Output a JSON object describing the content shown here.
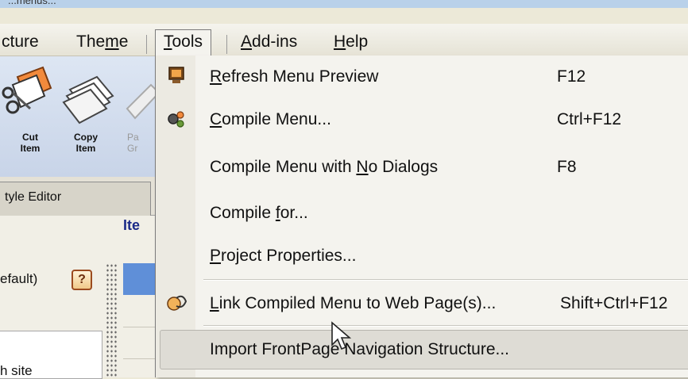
{
  "window": {
    "title_fragment": "...menus..."
  },
  "menubar": {
    "items": [
      {
        "id": "structure",
        "label_pre": "",
        "label_u": "",
        "label_post": "cture"
      },
      {
        "id": "theme",
        "label_pre": "The",
        "label_u": "m",
        "label_post": "e"
      },
      {
        "id": "tools",
        "label_pre": "",
        "label_u": "T",
        "label_post": "ools"
      },
      {
        "id": "addins",
        "label_pre": "",
        "label_u": "A",
        "label_post": "dd-ins"
      },
      {
        "id": "help",
        "label_pre": "",
        "label_u": "H",
        "label_post": "elp"
      }
    ]
  },
  "toolbar": {
    "cut": {
      "line1": "Cut",
      "line2": "Item"
    },
    "copy": {
      "line1": "Copy",
      "line2": "Item"
    },
    "paste": {
      "line1": "Pa",
      "line2": "Gr"
    }
  },
  "tabs": {
    "style_editor": "tyle Editor"
  },
  "panel": {
    "header": "Ite",
    "default_label": "efault)",
    "help_glyph": "?",
    "site_text": "h site"
  },
  "tools_menu": {
    "items": [
      {
        "pre": "",
        "u": "R",
        "post": "efresh Menu Preview",
        "shortcut": "F12",
        "icon": "monitor-refresh-icon"
      },
      {
        "pre": "",
        "u": "C",
        "post": "ompile Menu...",
        "shortcut": "Ctrl+F12",
        "icon": "gears-compile-icon"
      },
      {
        "pre": "Compile Menu with ",
        "u": "N",
        "post": "o Dialogs",
        "shortcut": "F8",
        "icon": ""
      },
      {
        "pre": "Compile ",
        "u": "f",
        "post": "or...",
        "shortcut": "",
        "icon": ""
      },
      {
        "pre": "",
        "u": "P",
        "post": "roject Properties...",
        "shortcut": "",
        "icon": ""
      },
      {
        "pre": "",
        "u": "L",
        "post": "ink Compiled Menu to Web Page(s)...",
        "shortcut": "Shift+Ctrl+F12",
        "icon": "link-web-icon"
      },
      {
        "pre": "Import FrontPage Navigation Structure...",
        "u": "",
        "post": "",
        "shortcut": "",
        "icon": ""
      }
    ]
  },
  "colors": {
    "menu_bg": "#f4f3ee",
    "highlight": "#dedcd5",
    "accent_blue": "#5f8fd8"
  }
}
